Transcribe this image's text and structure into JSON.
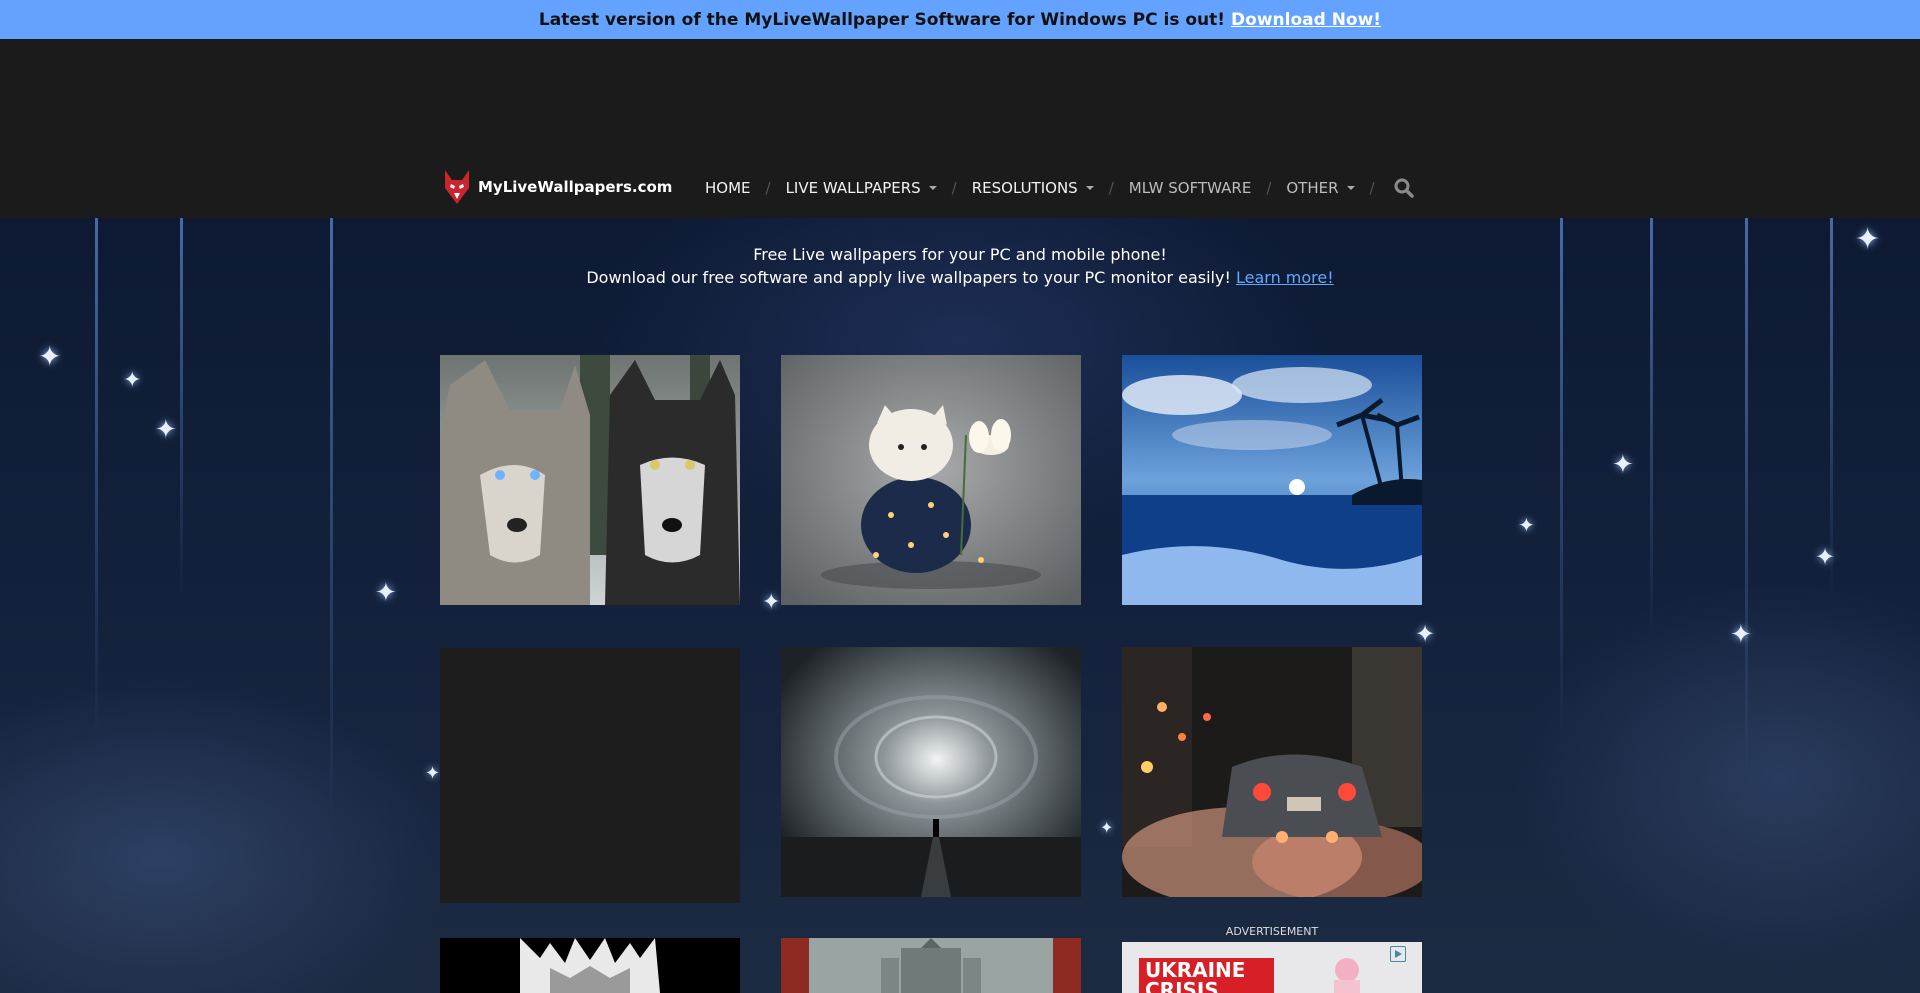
{
  "banner": {
    "text": "Latest version of the MyLiveWallpaper Software for Windows PC is out!",
    "link": "Download Now!"
  },
  "logo": {
    "text": "MyLiveWallpapers.com"
  },
  "nav": {
    "home": "HOME",
    "live_wallpapers": "LIVE WALLPAPERS",
    "resolutions": "RESOLUTIONS",
    "mlw_software": "MLW SOFTWARE",
    "other": "OTHER",
    "separator": "/"
  },
  "intro": {
    "line1": "Free Live wallpapers for your PC and mobile phone!",
    "line2": "Download our free software and apply live wallpapers to your PC monitor easily!",
    "learn_more": "Learn more!"
  },
  "ad": {
    "label": "ADVERTISEMENT",
    "headline": "UKRAINE CRISIS"
  },
  "icons": [
    "wolf-logo-icon",
    "caret-down-icon",
    "search-icon",
    "ad-choices-icon"
  ],
  "colors": {
    "banner": "#63a3ff",
    "topbar": "#1b1b1b",
    "link": "#62a8ff",
    "accent": "#d61f26"
  }
}
